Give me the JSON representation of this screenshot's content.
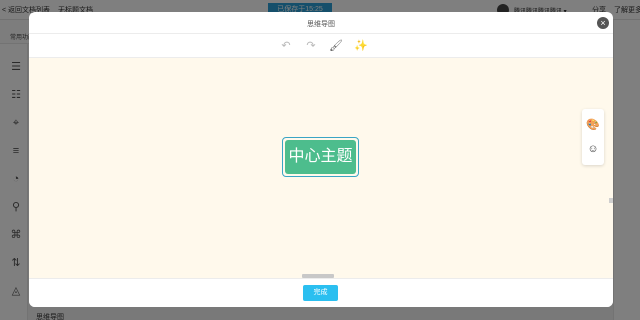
{
  "background": {
    "back_label": "< 返回文档列表",
    "doc_title": "无标题文档",
    "status": "已保存于15:25",
    "user_name": "腾讯腾讯腾讯腾讯 ▾",
    "share": "分享",
    "more": "了解更多",
    "tab_label": "常用功能",
    "bottom_label": "思维导图"
  },
  "modal": {
    "title": "思维导图",
    "close_icon": "×",
    "toolbar": {
      "undo_icon": "↶",
      "redo_icon": "↷",
      "format_icon": "🖌",
      "magic_icon": "✨"
    },
    "central_topic": "中心主题",
    "side_panel": {
      "palette_icon": "🎨",
      "emoji_icon": "☺"
    },
    "done_label": "完成"
  },
  "colors": {
    "topic_fill": "#4dbd8d",
    "topic_border": "#3aa5c5",
    "canvas_bg": "#fff9ec",
    "done_button": "#2bbff0"
  }
}
